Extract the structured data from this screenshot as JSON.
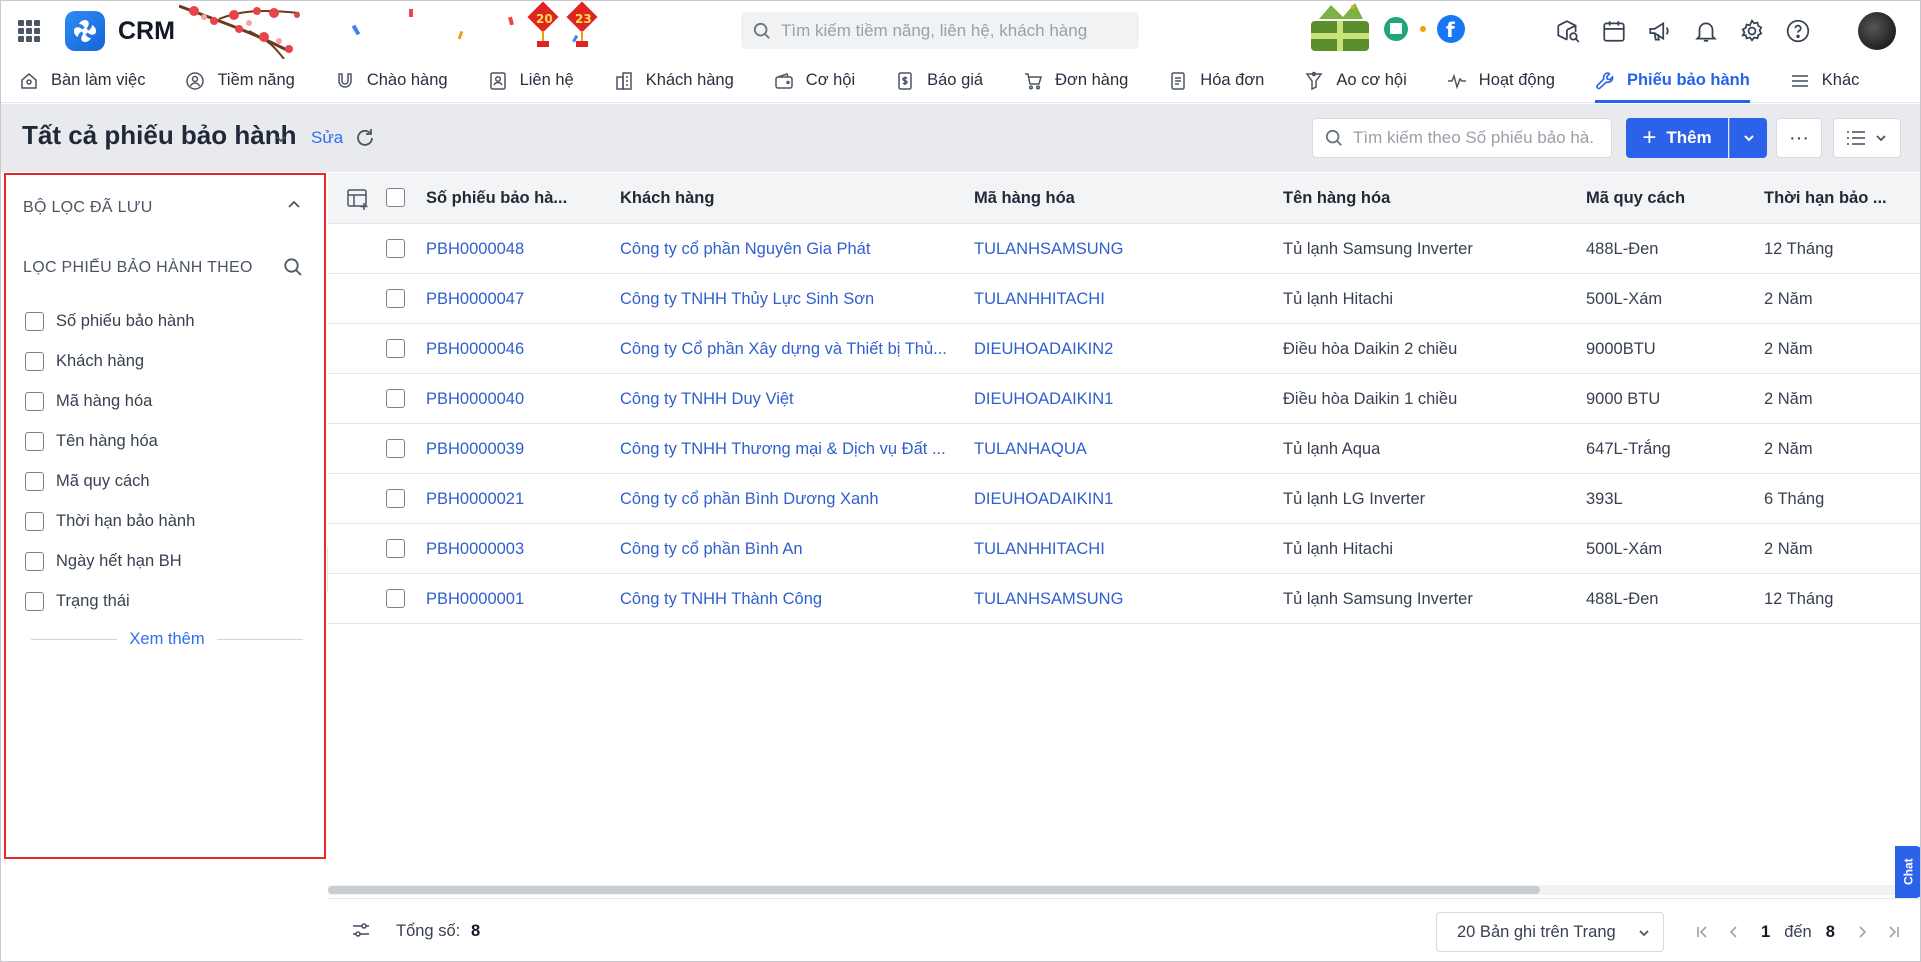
{
  "app": {
    "name": "CRM"
  },
  "search": {
    "placeholder": "Tìm kiếm tiềm năng, liên hệ, khách hàng"
  },
  "nav": [
    {
      "label": "Bàn làm việc",
      "icon": "home-icon"
    },
    {
      "label": "Tiềm năng",
      "icon": "user-circle-icon"
    },
    {
      "label": "Chào hàng",
      "icon": "magnet-icon"
    },
    {
      "label": "Liên hệ",
      "icon": "contact-card-icon"
    },
    {
      "label": "Khách hàng",
      "icon": "building-icon"
    },
    {
      "label": "Cơ hội",
      "icon": "wallet-icon"
    },
    {
      "label": "Báo giá",
      "icon": "dollar-doc-icon"
    },
    {
      "label": "Đơn hàng",
      "icon": "cart-icon"
    },
    {
      "label": "Hóa đơn",
      "icon": "invoice-icon"
    },
    {
      "label": "Ao cơ hội",
      "icon": "funnel-icon"
    },
    {
      "label": "Hoạt động",
      "icon": "activity-icon"
    },
    {
      "label": "Phiếu bảo hành",
      "icon": "wrench-icon",
      "active": true
    },
    {
      "label": "Khác",
      "icon": "menu-icon"
    }
  ],
  "header": {
    "title": "Tất cả phiếu bảo hành",
    "edit_label": "Sửa",
    "search_placeholder": "Tìm kiếm theo Số phiếu bảo hà...",
    "add_label": "Thêm",
    "more_label": "···"
  },
  "sidebar": {
    "saved_filters_title": "BỘ LỌC ĐÃ LƯU",
    "filter_by_title": "LỌC PHIẾU BẢO HÀNH THEO",
    "filters": [
      "Số phiếu bảo hành",
      "Khách hàng",
      "Mã hàng hóa",
      "Tên hàng hóa",
      "Mã quy cách",
      "Thời hạn bảo hành",
      "Ngày hết hạn BH",
      "Trạng thái"
    ],
    "see_more_label": "Xem thêm"
  },
  "table": {
    "columns": [
      "Số phiếu bảo hà...",
      "Khách hàng",
      "Mã hàng hóa",
      "Tên hàng hóa",
      "Mã quy cách",
      "Thời hạn bảo ..."
    ],
    "rows": [
      [
        "PBH0000048",
        "Công ty cổ phần Nguyên Gia Phát",
        "TULANHSAMSUNG",
        "Tủ lạnh Samsung Inverter",
        "488L-Đen",
        "12 Tháng"
      ],
      [
        "PBH0000047",
        "Công ty TNHH Thủy Lực Sinh Sơn",
        "TULANHHITACHI",
        "Tủ lạnh Hitachi",
        "500L-Xám",
        "2 Năm"
      ],
      [
        "PBH0000046",
        "Công ty Cổ phần Xây dựng và Thiết bị Thủ...",
        "DIEUHOADAIKIN2",
        "Điều hòa Daikin 2 chiều",
        "9000BTU",
        "2 Năm"
      ],
      [
        "PBH0000040",
        "Công ty TNHH Duy Việt",
        "DIEUHOADAIKIN1",
        "Điều hòa Daikin 1 chiều",
        "9000 BTU",
        "2 Năm"
      ],
      [
        "PBH0000039",
        "Công ty TNHH Thương mại & Dịch vụ Đất ...",
        "TULANHAQUA",
        "Tủ lạnh Aqua",
        "647L-Trắng",
        "2 Năm"
      ],
      [
        "PBH0000021",
        "Công ty cổ phần Bình Dương Xanh",
        "DIEUHOADAIKIN1",
        "Tủ lạnh LG Inverter",
        "393L",
        "6 Tháng"
      ],
      [
        "PBH0000003",
        "Công ty cổ phần Bình An",
        "TULANHHITACHI",
        "Tủ lạnh Hitachi",
        "500L-Xám",
        "2 Năm"
      ],
      [
        "PBH0000001",
        "Công ty TNHH Thành Công",
        "TULANHSAMSUNG",
        "Tủ lạnh Samsung Inverter",
        "488L-Đen",
        "12 Tháng"
      ]
    ]
  },
  "footer": {
    "total_label": "Tổng số:",
    "total_value": "8",
    "page_size_label": "20 Bản ghi trên Trang",
    "page_from": "1",
    "page_to_label": "đến",
    "page_to": "8"
  },
  "chat_label": "Chat",
  "colors": {
    "accent": "#2c62ea",
    "link": "#2f5fd0",
    "highlight_border": "#e32b2b"
  }
}
